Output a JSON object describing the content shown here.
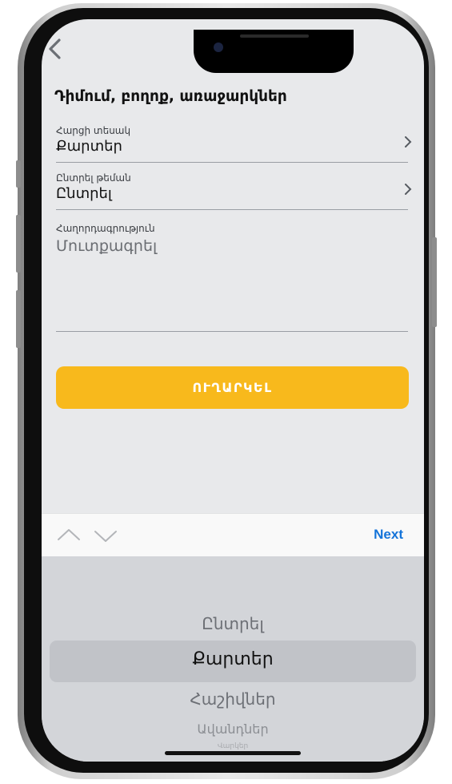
{
  "screen": {
    "title": "Դիմում, բողոք, առաջարկներ",
    "back_icon": "chevron-left-icon"
  },
  "form": {
    "request_type": {
      "label": "Հարցի տեսակ",
      "value": "Քարտեր"
    },
    "topic": {
      "label": "Ընտրել թեման",
      "value": "Ընտրել"
    },
    "message": {
      "label": "Հաղորդագրություն",
      "placeholder": "Մուտքագրել"
    },
    "submit_label": "ՈՒՂԱՐԿԵԼ"
  },
  "keyboard_toolbar": {
    "prev_icon": "chevron-up-icon",
    "next_icon": "chevron-down-icon",
    "next_label": "Next"
  },
  "picker": {
    "options": [
      "Ընտրել",
      "Քարտեր",
      "Հաշիվներ",
      "Ավանդներ",
      "Վարկեր"
    ],
    "selected": "Քարտեր"
  },
  "colors": {
    "accent": "#f8b91c",
    "link": "#1474d9",
    "screen_bg": "#e8e9eb",
    "picker_bg": "#d3d5d9"
  }
}
